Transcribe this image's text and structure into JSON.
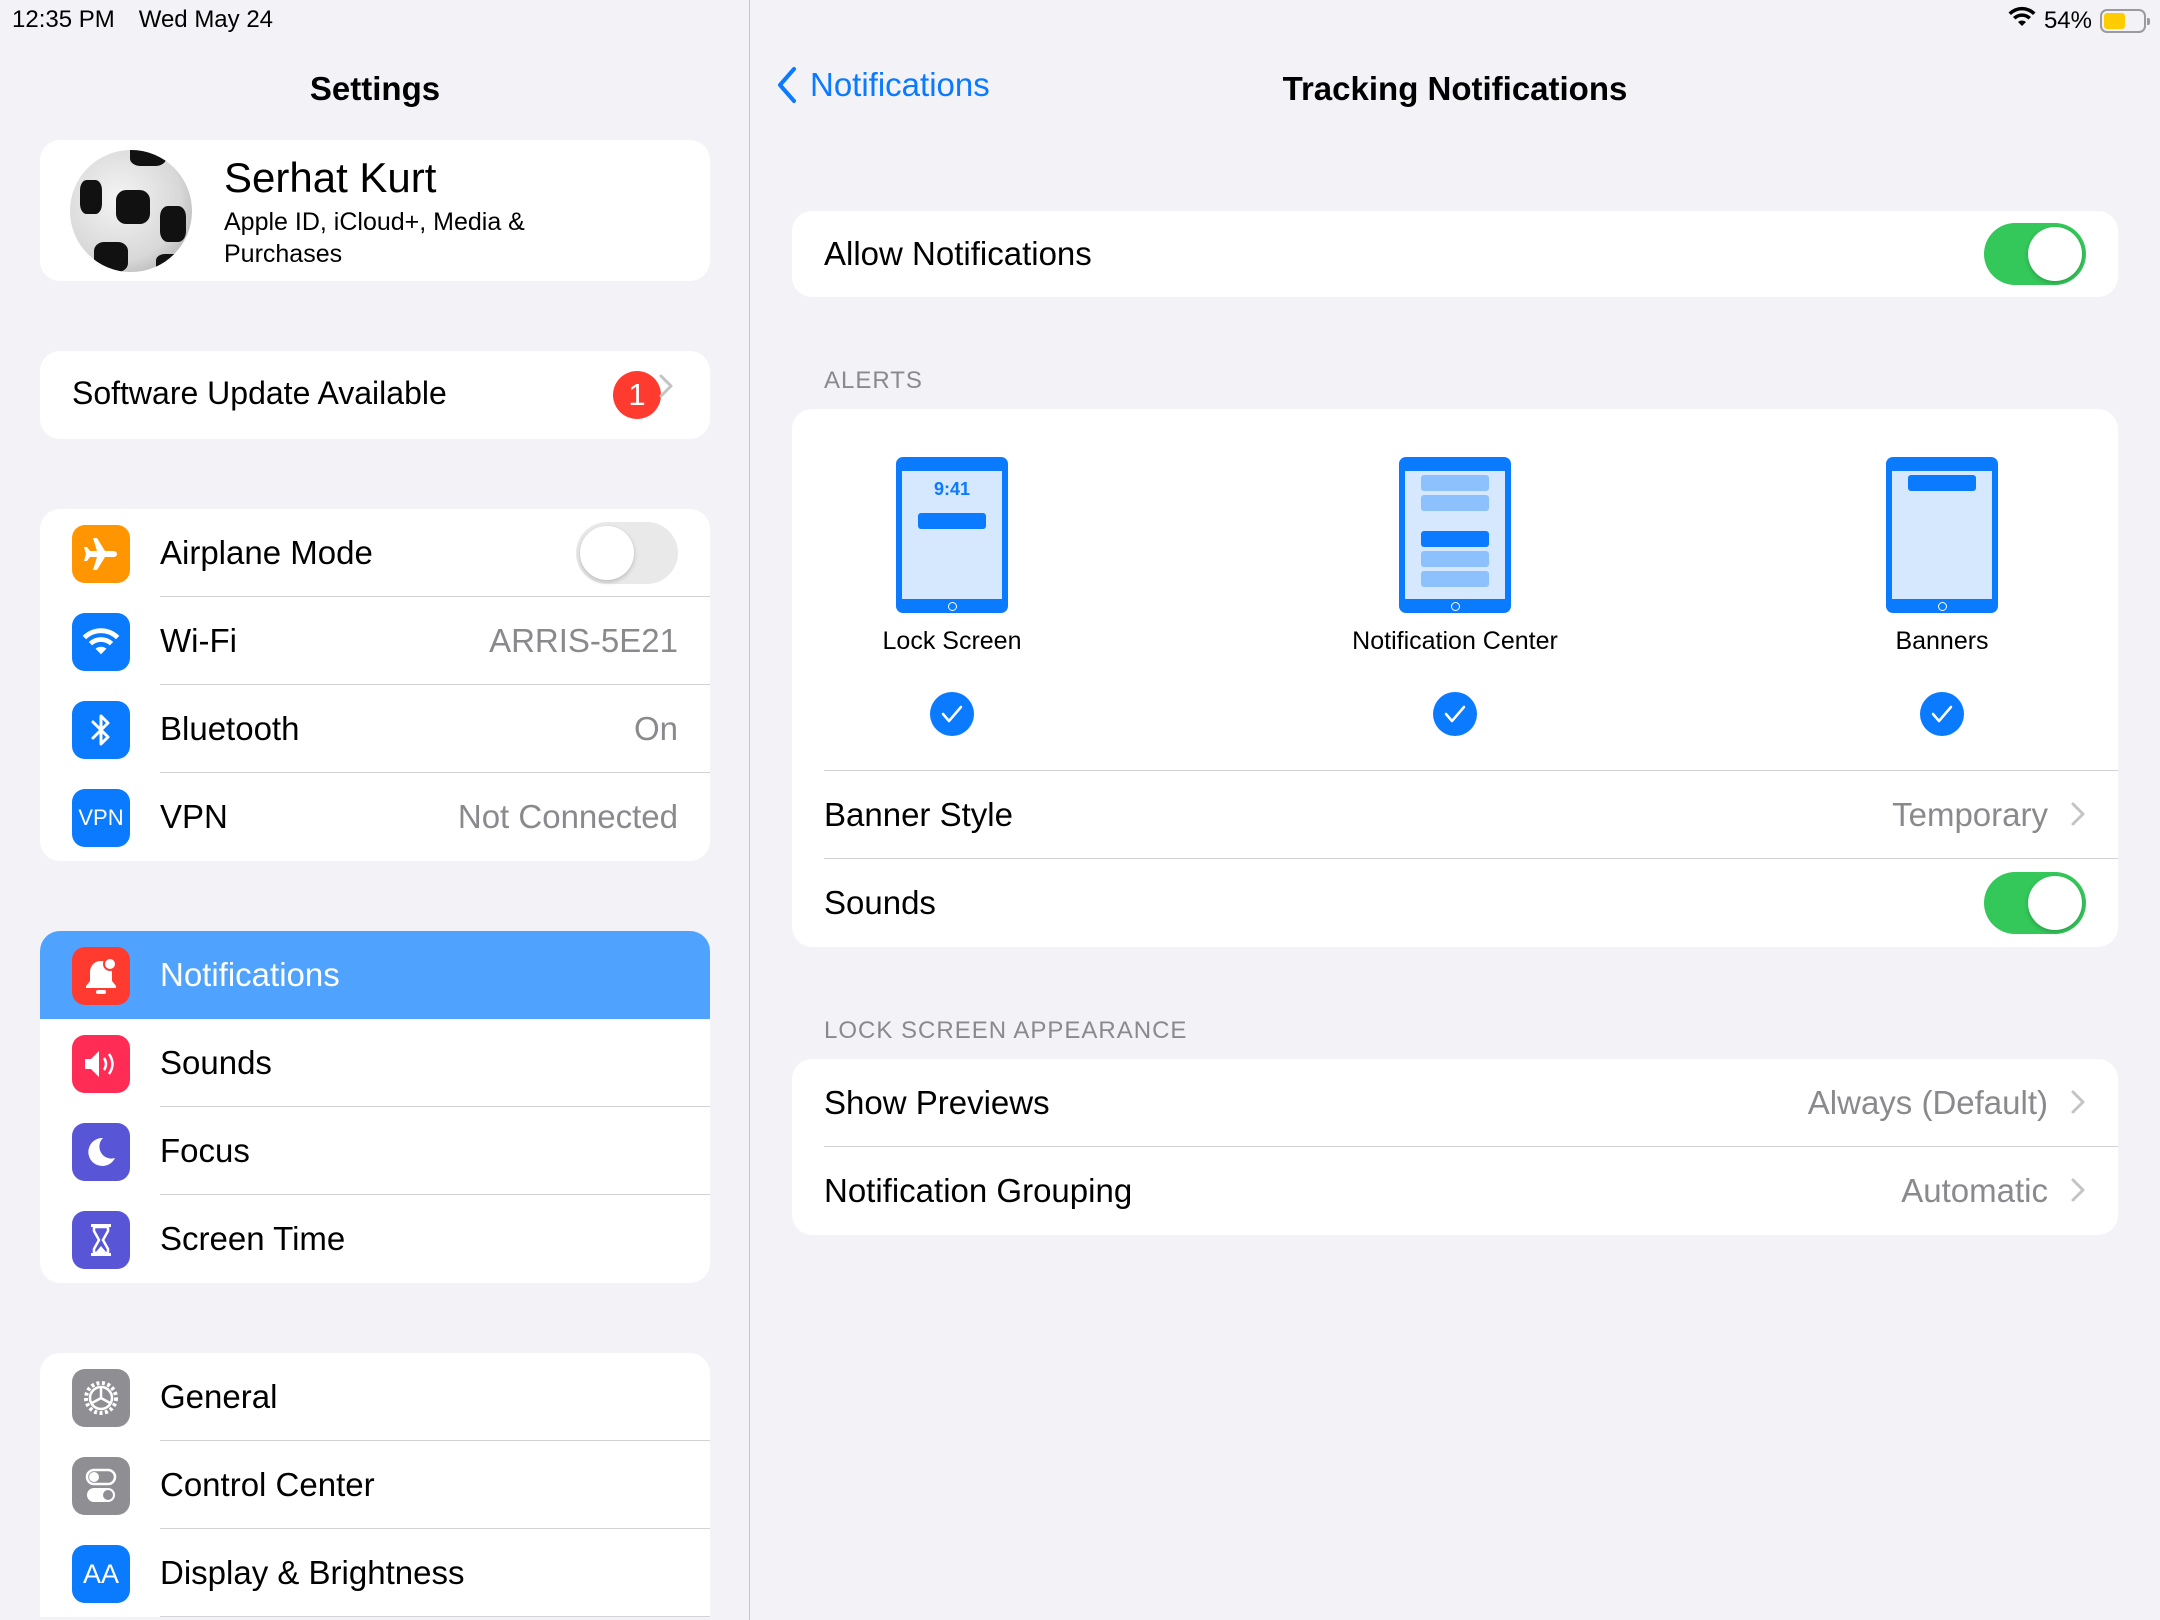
{
  "status_bar": {
    "time": "12:35 PM",
    "date": "Wed May 24",
    "battery_percent_label": "54%",
    "battery_level": 0.54
  },
  "sidebar": {
    "title": "Settings",
    "profile": {
      "name": "Serhat Kurt",
      "subtitle": "Apple ID, iCloud+, Media & Purchases"
    },
    "software_update": {
      "label": "Software Update Available",
      "badge": "1"
    },
    "connectivity": [
      {
        "label": "Airplane Mode",
        "icon": "airplane-icon",
        "color": "#ff9500",
        "toggle": false
      },
      {
        "label": "Wi-Fi",
        "icon": "wifi-icon",
        "color": "#0a7aff",
        "value": "ARRIS-5E21"
      },
      {
        "label": "Bluetooth",
        "icon": "bluetooth-icon",
        "color": "#0a7aff",
        "value": "On"
      },
      {
        "label": "VPN",
        "icon": "vpn-icon",
        "icon_text": "VPN",
        "color": "#0a7aff",
        "value": "Not Connected"
      }
    ],
    "attention": [
      {
        "label": "Notifications",
        "icon": "bell-icon",
        "color": "#ff3b30",
        "selected": true
      },
      {
        "label": "Sounds",
        "icon": "speaker-icon",
        "color": "#ff2d55"
      },
      {
        "label": "Focus",
        "icon": "moon-icon",
        "color": "#5856d6"
      },
      {
        "label": "Screen Time",
        "icon": "hourglass-icon",
        "color": "#5856d6"
      }
    ],
    "general": [
      {
        "label": "General",
        "icon": "gear-icon",
        "color": "#8e8e93"
      },
      {
        "label": "Control Center",
        "icon": "switches-icon",
        "color": "#8e8e93"
      },
      {
        "label": "Display & Brightness",
        "icon": "text-size-icon",
        "icon_text": "AA",
        "color": "#0a7aff"
      }
    ]
  },
  "detail": {
    "back_label": "Notifications",
    "title": "Tracking Notifications",
    "allow_notifications": {
      "label": "Allow Notifications",
      "on": true
    },
    "alerts_header": "ALERTS",
    "alert_options": [
      {
        "label": "Lock Screen",
        "checked": true,
        "preview_time": "9:41"
      },
      {
        "label": "Notification Center",
        "checked": true
      },
      {
        "label": "Banners",
        "checked": true
      }
    ],
    "banner_style": {
      "label": "Banner Style",
      "value": "Temporary"
    },
    "sounds": {
      "label": "Sounds",
      "on": true
    },
    "lock_screen_header": "LOCK SCREEN APPEARANCE",
    "show_previews": {
      "label": "Show Previews",
      "value": "Always (Default)"
    },
    "notification_grouping": {
      "label": "Notification Grouping",
      "value": "Automatic"
    }
  },
  "colors": {
    "accent": "#0a7aff",
    "toggle_on": "#34c759",
    "selected_row": "#4fa3fe",
    "badge": "#ff3b30",
    "battery": "#ffcc00"
  }
}
